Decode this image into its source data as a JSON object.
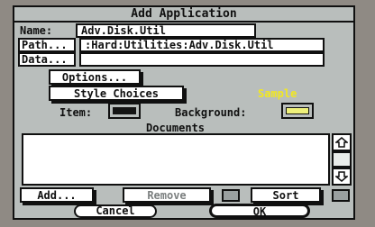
{
  "dialog": {
    "title": "Add Application",
    "name_label": "Name:",
    "name_value": "Adv.Disk.Util",
    "path_label": "Path...",
    "path_value": ":Hard:Utilities:Adv.Disk.Util",
    "data_label": "Data...",
    "data_value": "",
    "options_label": "Options...",
    "style_choices_label": "Style Choices",
    "sample_label": "Sample",
    "item_label": "Item:",
    "background_label": "Background:",
    "documents_label": "Documents",
    "documents_items": [],
    "add_label": "Add...",
    "remove_label": "Remove",
    "sort_label": "Sort",
    "cancel_label": "Cancel",
    "ok_label": "OK"
  },
  "colors": {
    "sample_text": "#f2e820",
    "item_swatch": "#141414",
    "background_swatch": "#eef07a",
    "dialog_bg": "#b9bebc"
  },
  "icons": [
    "up-arrow-icon",
    "down-arrow-icon"
  ]
}
